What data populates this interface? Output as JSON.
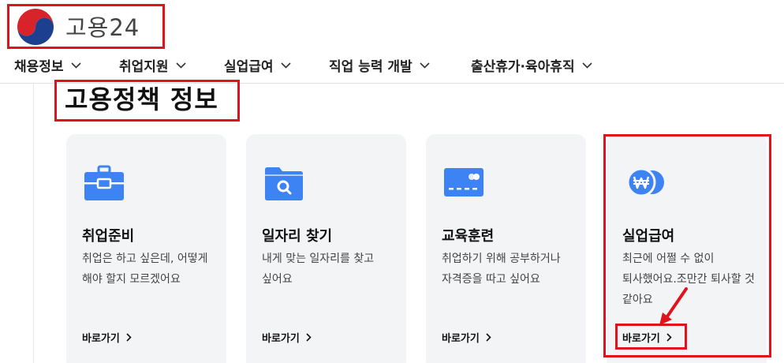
{
  "header": {
    "brand": "고용24"
  },
  "nav": {
    "items": [
      {
        "label": "채용정보"
      },
      {
        "label": "취업지원"
      },
      {
        "label": "실업급여"
      },
      {
        "label": "직업 능력 개발"
      },
      {
        "label": "출산휴가·육아휴직"
      }
    ]
  },
  "page": {
    "title": "고용정책 정보"
  },
  "cards": [
    {
      "title": "취업준비",
      "desc": "취업은 하고 싶은데, 어떻게 해야 할지 모르겠어요",
      "link": "바로가기",
      "icon": "briefcase-icon"
    },
    {
      "title": "일자리 찾기",
      "desc": "내게 맞는 일자리를 찾고 싶어요",
      "link": "바로가기",
      "icon": "folder-search-icon"
    },
    {
      "title": "교육훈련",
      "desc": "취업하기 위해 공부하거나 자격증을 따고 싶어요",
      "link": "바로가기",
      "icon": "card-icon"
    },
    {
      "title": "실업급여",
      "desc": "최근에 어쩔 수 없이 퇴사했어요.조만간 퇴사할 것 같아요",
      "link": "바로가기",
      "icon": "won-coin-icon"
    }
  ],
  "colors": {
    "accent": "#3e83f3",
    "highlight": "#e0131d",
    "card_bg": "#f3f4f6"
  }
}
